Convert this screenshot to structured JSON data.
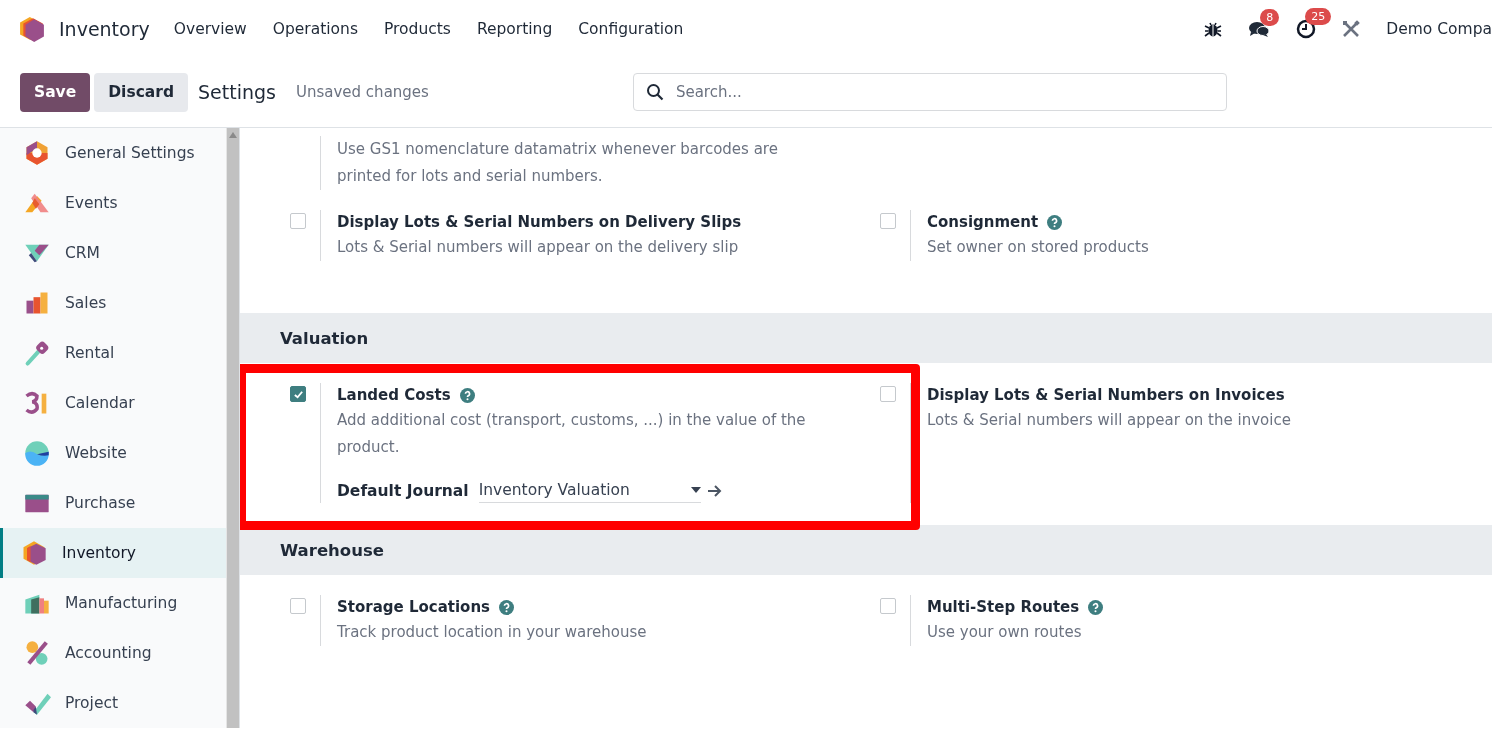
{
  "navbar": {
    "app_name": "Inventory",
    "menu": [
      "Overview",
      "Operations",
      "Products",
      "Reporting",
      "Configuration"
    ],
    "messages_badge": "8",
    "activities_badge": "25",
    "company": "Demo Compa"
  },
  "control_panel": {
    "save": "Save",
    "discard": "Discard",
    "breadcrumb": "Settings",
    "status": "Unsaved changes",
    "search": {
      "placeholder": "Search..."
    }
  },
  "sidebar": {
    "items": [
      {
        "label": "General Settings",
        "selected": false
      },
      {
        "label": "Events",
        "selected": false
      },
      {
        "label": "CRM",
        "selected": false
      },
      {
        "label": "Sales",
        "selected": false
      },
      {
        "label": "Rental",
        "selected": false
      },
      {
        "label": "Calendar",
        "selected": false
      },
      {
        "label": "Website",
        "selected": false
      },
      {
        "label": "Purchase",
        "selected": false
      },
      {
        "label": "Inventory",
        "selected": true
      },
      {
        "label": "Manufacturing",
        "selected": false
      },
      {
        "label": "Accounting",
        "selected": false
      },
      {
        "label": "Project",
        "selected": false
      }
    ]
  },
  "sections": [
    {
      "rows": [
        [
          {
            "kind": "text",
            "description": "Use GS1 nomenclature datamatrix whenever barcodes are printed for lots and serial numbers."
          }
        ],
        [
          {
            "kind": "checkbox",
            "title": "Display Lots & Serial Numbers on Delivery Slips",
            "checked": false,
            "help": false,
            "highlighted": false,
            "description": "Lots & Serial numbers will appear on the delivery slip"
          },
          {
            "kind": "checkbox",
            "title": "Consignment",
            "checked": false,
            "help": true,
            "highlighted": false,
            "description": "Set owner on stored products"
          }
        ]
      ]
    },
    {
      "title": "Valuation",
      "rows": [
        [
          {
            "kind": "checkbox",
            "title": "Landed Costs",
            "checked": true,
            "help": true,
            "highlighted": true,
            "description": "Add additional cost (transport, customs, ...) in the value of the product.",
            "field": {
              "label": "Default Journal",
              "value": "Inventory Valuation"
            }
          },
          {
            "kind": "checkbox",
            "title": "Display Lots & Serial Numbers on Invoices",
            "checked": false,
            "help": false,
            "highlighted": false,
            "description": "Lots & Serial numbers will appear on the invoice"
          }
        ]
      ]
    },
    {
      "title": "Warehouse",
      "rows": [
        [
          {
            "kind": "checkbox",
            "title": "Storage Locations",
            "checked": false,
            "help": true,
            "highlighted": false,
            "description": "Track product location in your warehouse"
          },
          {
            "kind": "checkbox",
            "title": "Multi-Step Routes",
            "checked": false,
            "help": true,
            "highlighted": false,
            "description": "Use your own routes"
          }
        ]
      ]
    }
  ]
}
